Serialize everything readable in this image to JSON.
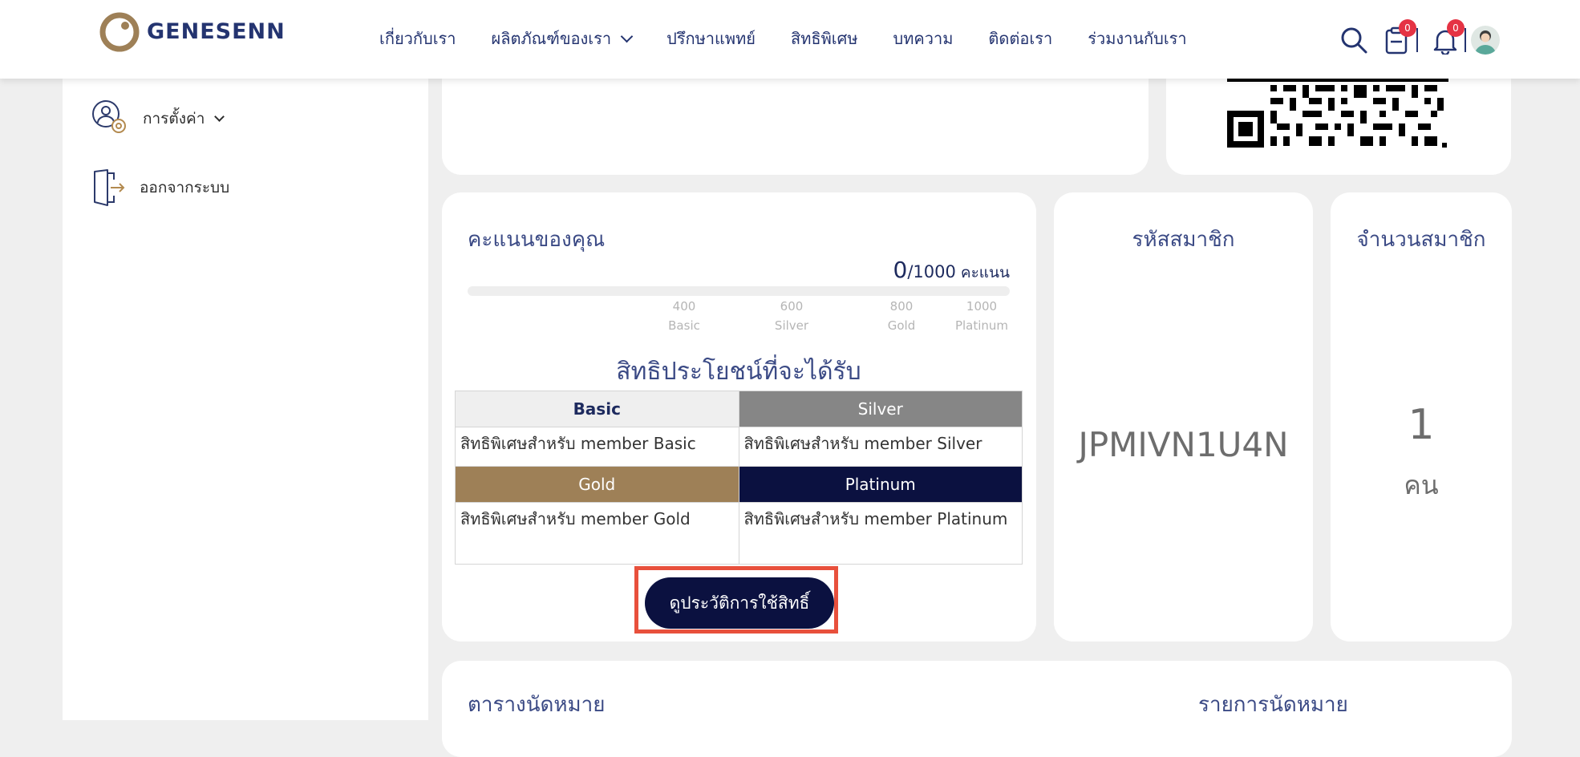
{
  "header": {
    "logo_text": "GENESENN",
    "nav": [
      {
        "label": "เกี่ยวกับเรา"
      },
      {
        "label": "ผลิตภัณฑ์ของเรา"
      },
      {
        "label": "ปรึกษาแพทย์"
      },
      {
        "label": "สิทธิพิเศษ"
      },
      {
        "label": "บทความ"
      },
      {
        "label": "ติดต่อเรา"
      },
      {
        "label": "ร่วมงานกับเรา"
      }
    ],
    "cart_count": "0",
    "notification_count": "0"
  },
  "sidebar": {
    "items": [
      {
        "label": "การตั้งค่า"
      },
      {
        "label": "ออกจากระบบ"
      }
    ]
  },
  "points": {
    "title": "คะแนนของคุณ",
    "current": "0",
    "total": "/1000",
    "unit": "คะแนน",
    "progress_fraction": 0,
    "ticks": [
      {
        "value": "400",
        "tier": "Basic"
      },
      {
        "value": "600",
        "tier": "Silver"
      },
      {
        "value": "800",
        "tier": "Gold"
      },
      {
        "value": "1000",
        "tier": "Platinum"
      }
    ]
  },
  "benefits": {
    "title": "สิทธิประโยชน์ที่จะได้รับ",
    "basic": {
      "name": "Basic",
      "desc": "สิทธิพิเศษสำหรับ member Basic"
    },
    "silver": {
      "name": "Silver",
      "desc": "สิทธิพิเศษสำหรับ member Silver"
    },
    "gold": {
      "name": "Gold",
      "desc": "สิทธิพิเศษสำหรับ member Gold"
    },
    "platinum": {
      "name": "Platinum",
      "desc": "สิทธิพิเศษสำหรับ member Platinum"
    },
    "history_button": "ดูประวัติการใช้สิทธิ์"
  },
  "member_code": {
    "title": "รหัสสมาชิก",
    "value": "JPMIVN1U4N"
  },
  "member_count": {
    "title": "จำนวนสมาชิก",
    "value": "1",
    "unit": "คน"
  },
  "appointments": {
    "title": "ตารางนัดหมาย",
    "list_title": "รายการนัดหมาย"
  },
  "colors": {
    "primary": "#0b1140",
    "gold": "#9e8057",
    "silver": "#868686",
    "badge": "#e53344",
    "highlight": "#e8503c"
  }
}
